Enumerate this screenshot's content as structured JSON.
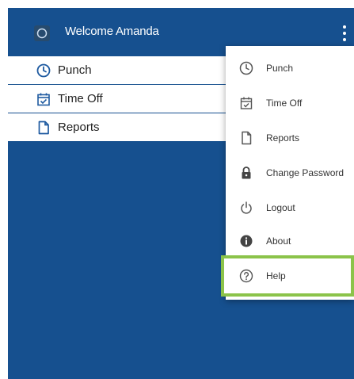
{
  "header": {
    "title": "Welcome Amanda",
    "app_icon": "clock-icon",
    "menu_icon": "kebab-menu-icon"
  },
  "nav": [
    {
      "label": "Punch",
      "icon": "clock-icon"
    },
    {
      "label": "Time Off",
      "icon": "calendar-check-icon"
    },
    {
      "label": "Reports",
      "icon": "document-icon"
    }
  ],
  "menu": [
    {
      "label": "Punch",
      "icon": "clock-icon"
    },
    {
      "label": "Time Off",
      "icon": "calendar-check-icon"
    },
    {
      "label": "Reports",
      "icon": "document-icon"
    },
    {
      "label": "Change Password",
      "icon": "lock-icon"
    },
    {
      "label": "Logout",
      "icon": "power-icon"
    },
    {
      "label": "About",
      "icon": "info-icon"
    },
    {
      "label": "Help",
      "icon": "help-icon"
    }
  ],
  "colors": {
    "primary": "#16508f",
    "nav_icon": "#1e5aa0",
    "highlight": "#8bc34a"
  }
}
